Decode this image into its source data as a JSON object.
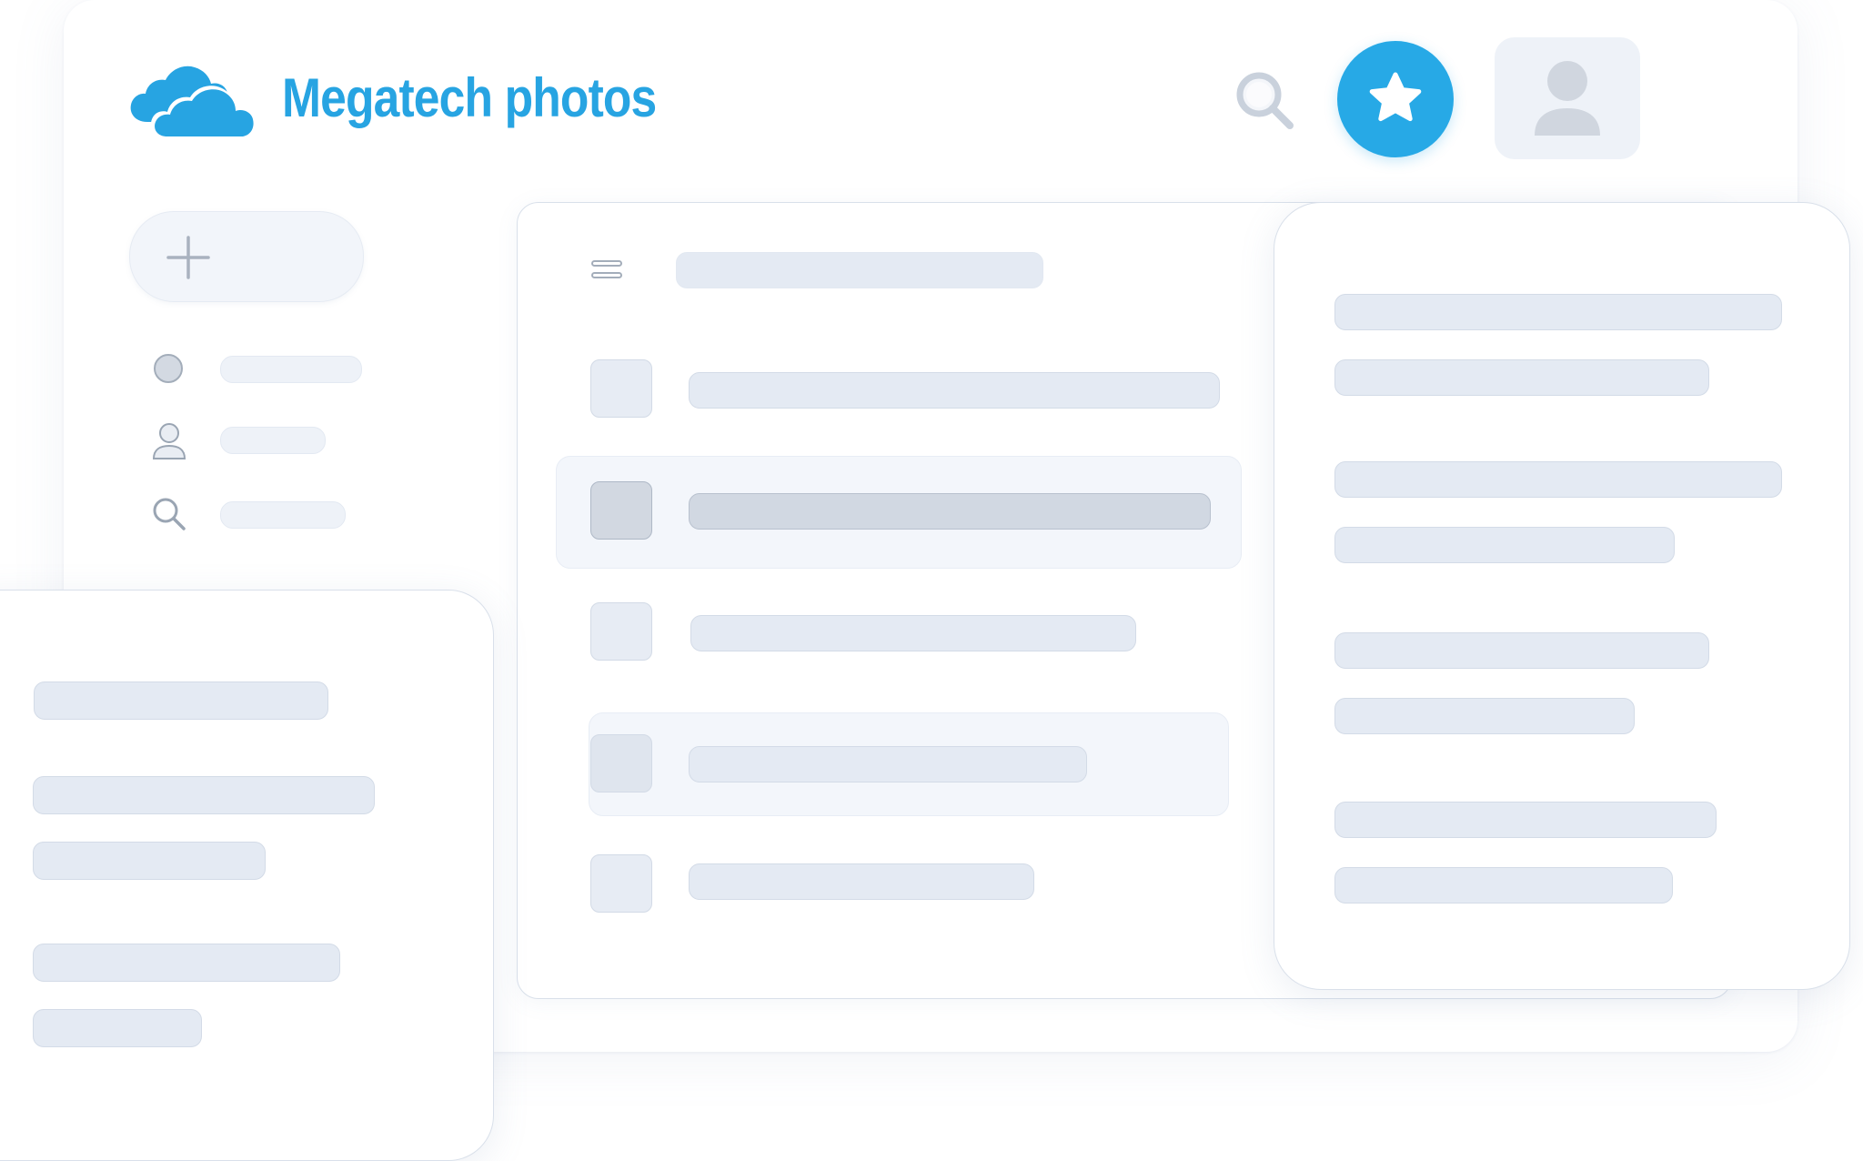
{
  "app": {
    "name": "Megatech photos",
    "logo_icon": "cloud-icon"
  },
  "header": {
    "search_icon": "search-icon",
    "favorites_icon": "star-icon",
    "account_icon": "user-icon"
  },
  "sidebar": {
    "new_icon": "plus-icon",
    "items": [
      {
        "icon": "circle-icon"
      },
      {
        "icon": "user-icon"
      },
      {
        "icon": "search-icon"
      }
    ]
  },
  "list_panel": {
    "menu_icon": "menu-icon",
    "rows": [
      {
        "state": "normal"
      },
      {
        "state": "selected"
      },
      {
        "state": "normal"
      },
      {
        "state": "hovered"
      },
      {
        "state": "normal"
      }
    ]
  },
  "colors": {
    "brand": "#27a4e2",
    "favorites_button": "#27a9e6",
    "placeholder": "#e4eaf3",
    "placeholder_selected": "#d1d8e2",
    "panel_border": "#d9e0ea"
  }
}
